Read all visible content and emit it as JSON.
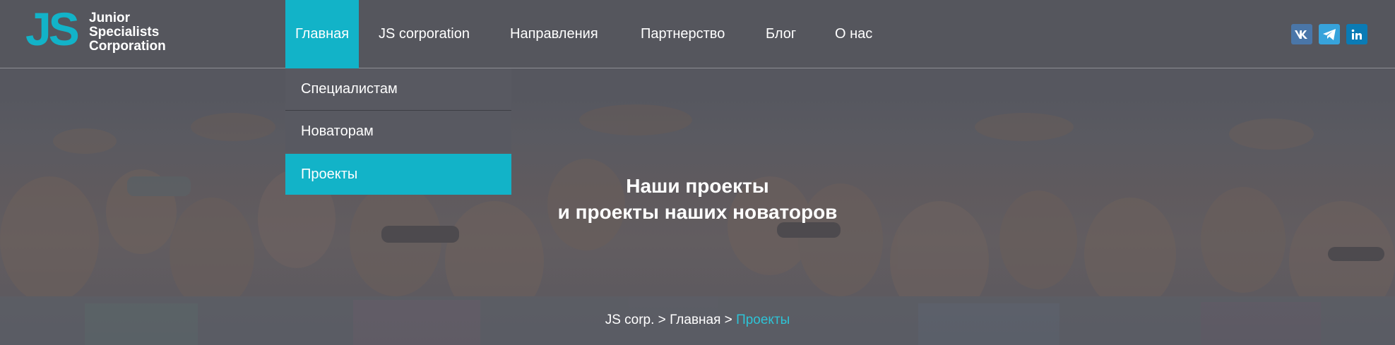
{
  "brand": {
    "logo_mark": "JS",
    "logo_lines": [
      "Junior",
      "Specialists",
      "Corporation"
    ],
    "accent_color": "#12b3c8"
  },
  "nav": {
    "items": [
      {
        "label": "Главная",
        "active": true
      },
      {
        "label": "JS corporation",
        "active": false
      },
      {
        "label": "Направления",
        "active": false
      },
      {
        "label": "Партнерство",
        "active": false
      },
      {
        "label": "Блог",
        "active": false
      },
      {
        "label": "О нас",
        "active": false
      }
    ]
  },
  "dropdown": {
    "items": [
      {
        "label": "Специалистам",
        "active": false
      },
      {
        "label": "Новаторам",
        "active": false
      },
      {
        "label": "Проекты",
        "active": true
      }
    ]
  },
  "social": [
    {
      "icon": "vk-icon",
      "color": "#4a76a8"
    },
    {
      "icon": "telegram-icon",
      "color": "#37a3db"
    },
    {
      "icon": "linkedin-icon",
      "color": "#0a7bb5"
    }
  ],
  "hero": {
    "title_line1": "Наши проекты",
    "title_line2": "и проекты наших новаторов"
  },
  "breadcrumbs": {
    "items": [
      "JS corp.",
      "Главная",
      "Проекты"
    ],
    "separator": ">"
  }
}
